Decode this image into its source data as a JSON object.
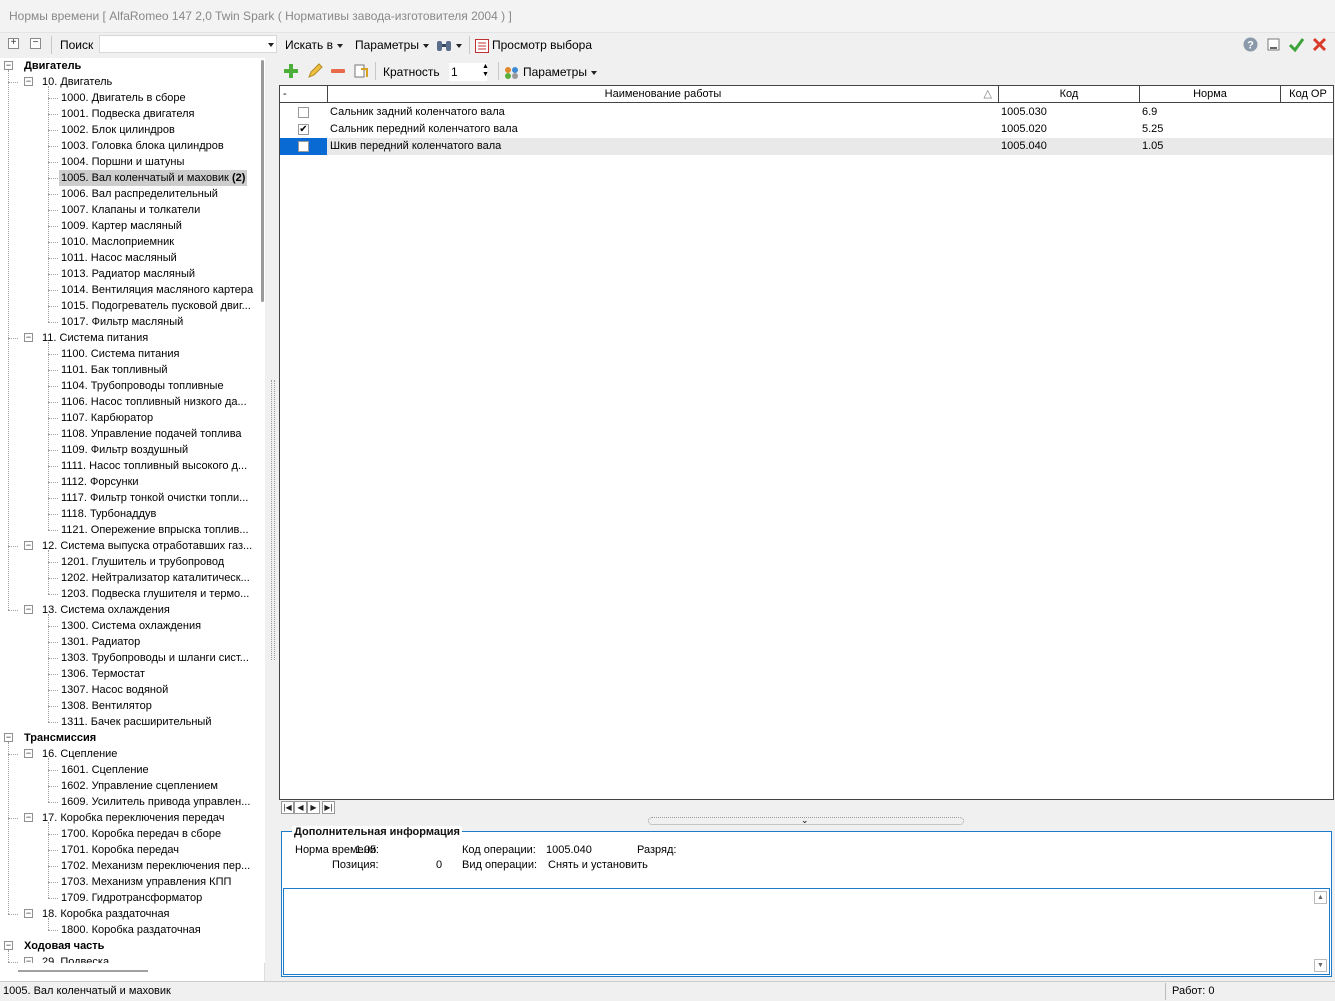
{
  "window": {
    "title": "Нормы времени [ AlfaRomeo 147 2,0 Twin Spark ( Нормативы завода-изготовителя 2004 ) ]"
  },
  "toolbar": {
    "search_label": "Поиск",
    "search_value": "",
    "search_in": "Искать в",
    "params": "Параметры",
    "preview": "Просмотр выбора"
  },
  "tree": [
    {
      "label": "Двигатель",
      "level": 0,
      "group": true
    },
    {
      "label": "10. Двигатель",
      "level": 1
    },
    {
      "label": "1000. Двигатель в сборе",
      "level": 2
    },
    {
      "label": "1001. Подвеска двигателя",
      "level": 2
    },
    {
      "label": "1002. Блок цилиндров",
      "level": 2
    },
    {
      "label": "1003. Головка блока цилиндров",
      "level": 2
    },
    {
      "label": "1004. Поршни и шатуны",
      "level": 2
    },
    {
      "label": "1005. Вал коленчатый и маховик",
      "level": 2,
      "selected": true,
      "count": "(2)"
    },
    {
      "label": "1006. Вал распределительный",
      "level": 2
    },
    {
      "label": "1007. Клапаны и толкатели",
      "level": 2
    },
    {
      "label": "1009. Картер масляный",
      "level": 2
    },
    {
      "label": "1010. Маслоприемник",
      "level": 2
    },
    {
      "label": "1011. Насос масляный",
      "level": 2
    },
    {
      "label": "1013. Радиатор масляный",
      "level": 2
    },
    {
      "label": "1014. Вентиляция масляного картера",
      "level": 2
    },
    {
      "label": "1015. Подогреватель пусковой двиг...",
      "level": 2
    },
    {
      "label": "1017. Фильтр масляный",
      "level": 2
    },
    {
      "label": "11. Система питания",
      "level": 1
    },
    {
      "label": "1100. Система питания",
      "level": 2
    },
    {
      "label": "1101. Бак топливный",
      "level": 2
    },
    {
      "label": "1104. Трубопроводы топливные",
      "level": 2
    },
    {
      "label": "1106. Насос топливный низкого да...",
      "level": 2
    },
    {
      "label": "1107. Карбюратор",
      "level": 2
    },
    {
      "label": "1108. Управление подачей топлива",
      "level": 2
    },
    {
      "label": "1109. Фильтр воздушный",
      "level": 2
    },
    {
      "label": "1111. Насос топливный высокого д...",
      "level": 2
    },
    {
      "label": "1112. Форсунки",
      "level": 2
    },
    {
      "label": "1117. Фильтр тонкой очистки топли...",
      "level": 2
    },
    {
      "label": "1118. Турбонаддув",
      "level": 2
    },
    {
      "label": "1121. Опережение впрыска топлив...",
      "level": 2
    },
    {
      "label": "12. Система выпуска отработавших газ...",
      "level": 1
    },
    {
      "label": "1201. Глушитель и трубопровод",
      "level": 2
    },
    {
      "label": "1202. Нейтрализатор каталитическ...",
      "level": 2
    },
    {
      "label": "1203. Подвеска глушителя и термо...",
      "level": 2
    },
    {
      "label": "13. Система охлаждения",
      "level": 1
    },
    {
      "label": "1300. Система охлаждения",
      "level": 2
    },
    {
      "label": "1301. Радиатор",
      "level": 2
    },
    {
      "label": "1303. Трубопроводы и шланги сист...",
      "level": 2
    },
    {
      "label": "1306. Термостат",
      "level": 2
    },
    {
      "label": "1307. Насос водяной",
      "level": 2
    },
    {
      "label": "1308. Вентилятор",
      "level": 2
    },
    {
      "label": "1311. Бачек расширительный",
      "level": 2
    },
    {
      "label": "Трансмиссия",
      "level": 0,
      "group": true
    },
    {
      "label": "16. Сцепление",
      "level": 1
    },
    {
      "label": "1601. Сцепление",
      "level": 2
    },
    {
      "label": "1602. Управление сцеплением",
      "level": 2
    },
    {
      "label": "1609. Усилитель привода управлен...",
      "level": 2
    },
    {
      "label": "17. Коробка переключения передач",
      "level": 1
    },
    {
      "label": "1700. Коробка передач в сборе",
      "level": 2
    },
    {
      "label": "1701. Коробка передач",
      "level": 2
    },
    {
      "label": "1702. Механизм переключения пер...",
      "level": 2
    },
    {
      "label": "1703. Механизм управления КПП",
      "level": 2
    },
    {
      "label": "1709. Гидротрансформатор",
      "level": 2
    },
    {
      "label": "18. Коробка раздаточная",
      "level": 1
    },
    {
      "label": "1800. Коробка раздаточная",
      "level": 2
    },
    {
      "label": "Ходовая часть",
      "level": 0,
      "group": true
    },
    {
      "label": "29. Подвеска",
      "level": 1
    }
  ],
  "grid_toolbar": {
    "multiplicity_label": "Кратность",
    "multiplicity_value": "1",
    "params": "Параметры"
  },
  "grid": {
    "columns": [
      "-",
      "Наименование работы",
      "Код",
      "Норма",
      "Код ОР"
    ],
    "sort_indicator": "△",
    "rows": [
      {
        "name": "Сальник задний коленчатого вала",
        "code": "1005.030",
        "norm": "6.9",
        "op": "",
        "checked": false
      },
      {
        "name": "Сальник передний коленчатого вала",
        "code": "1005.020",
        "norm": "5.25",
        "op": "",
        "checked": true
      },
      {
        "name": "Шкив передний коленчатого вала",
        "code": "1005.040",
        "norm": "1.05",
        "op": "",
        "checked": false,
        "selected": true
      }
    ]
  },
  "info": {
    "title": "Дополнительная информация",
    "norm_label": "Норма времени:",
    "norm_value": "1.05",
    "code_label": "Код операции:",
    "code_value": "1005.040",
    "rank_label": "Разряд:",
    "rank_value": "",
    "pos_label": "Позиция:",
    "pos_value": "0",
    "type_label": "Вид операции:",
    "type_value": "Снять и установить",
    "notes": ""
  },
  "status": {
    "left": "1005. Вал коленчатый и маховик",
    "right": "Работ: 0"
  }
}
